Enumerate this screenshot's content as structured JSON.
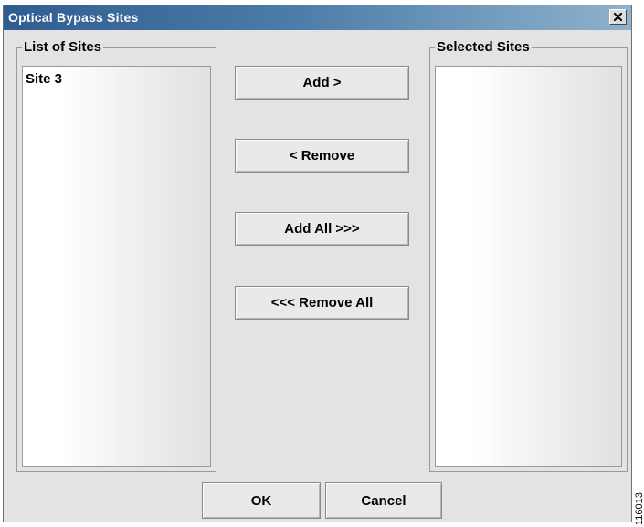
{
  "dialog": {
    "title": "Optical Bypass Sites",
    "close_icon": "close-icon"
  },
  "list_of_sites": {
    "label": "List of Sites",
    "items": [
      "Site 3"
    ]
  },
  "selected_sites": {
    "label": "Selected Sites",
    "items": []
  },
  "buttons": {
    "add": "Add >",
    "remove": "< Remove",
    "add_all": "Add All >>>",
    "remove_all": "<<< Remove All",
    "ok": "OK",
    "cancel": "Cancel"
  },
  "figure_id": "116013",
  "colors": {
    "titlebar_start": "#2f5d90",
    "titlebar_end": "#8fb2cc",
    "dialog_bg": "#e3e3e3"
  }
}
